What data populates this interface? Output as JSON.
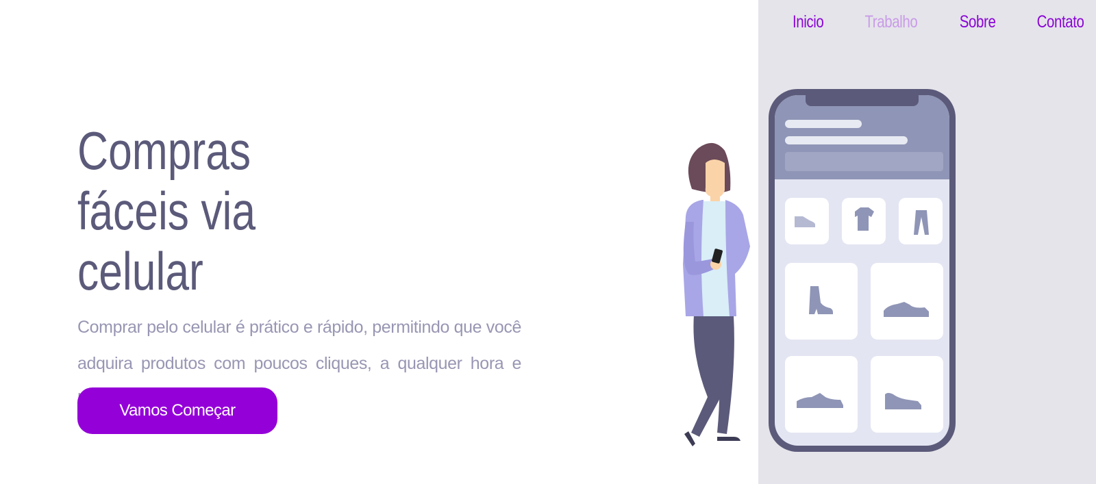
{
  "nav": {
    "items": [
      {
        "label": "Inicio",
        "active": false
      },
      {
        "label": "Trabalho",
        "active": true
      },
      {
        "label": "Sobre",
        "active": false
      },
      {
        "label": "Contato",
        "active": false
      }
    ]
  },
  "hero": {
    "title_line1": "Compras",
    "title_line2": "fáceis via",
    "title_line3": "celular",
    "description": "Comprar pelo celular é prático e rápido, permitindo que você adquira produtos com poucos cliques, a qualquer hora e lugar.",
    "cta_label": "Vamos Começar"
  },
  "colors": {
    "accent": "#9400d8",
    "nav_link": "#8a05d6",
    "nav_active": "#c99be8",
    "title": "#5b5a7a",
    "text_muted": "#9896b3",
    "panel_bg": "#e5e4ea",
    "phone_frame": "#5b5a7a"
  },
  "illustration": {
    "subject": "woman-with-smartphone",
    "phone_products": [
      "flat-shoe-icon",
      "t-shirt-icon",
      "pants-icon",
      "boot-icon",
      "sneaker-icon",
      "sneaker-icon",
      "sneaker-icon"
    ]
  }
}
